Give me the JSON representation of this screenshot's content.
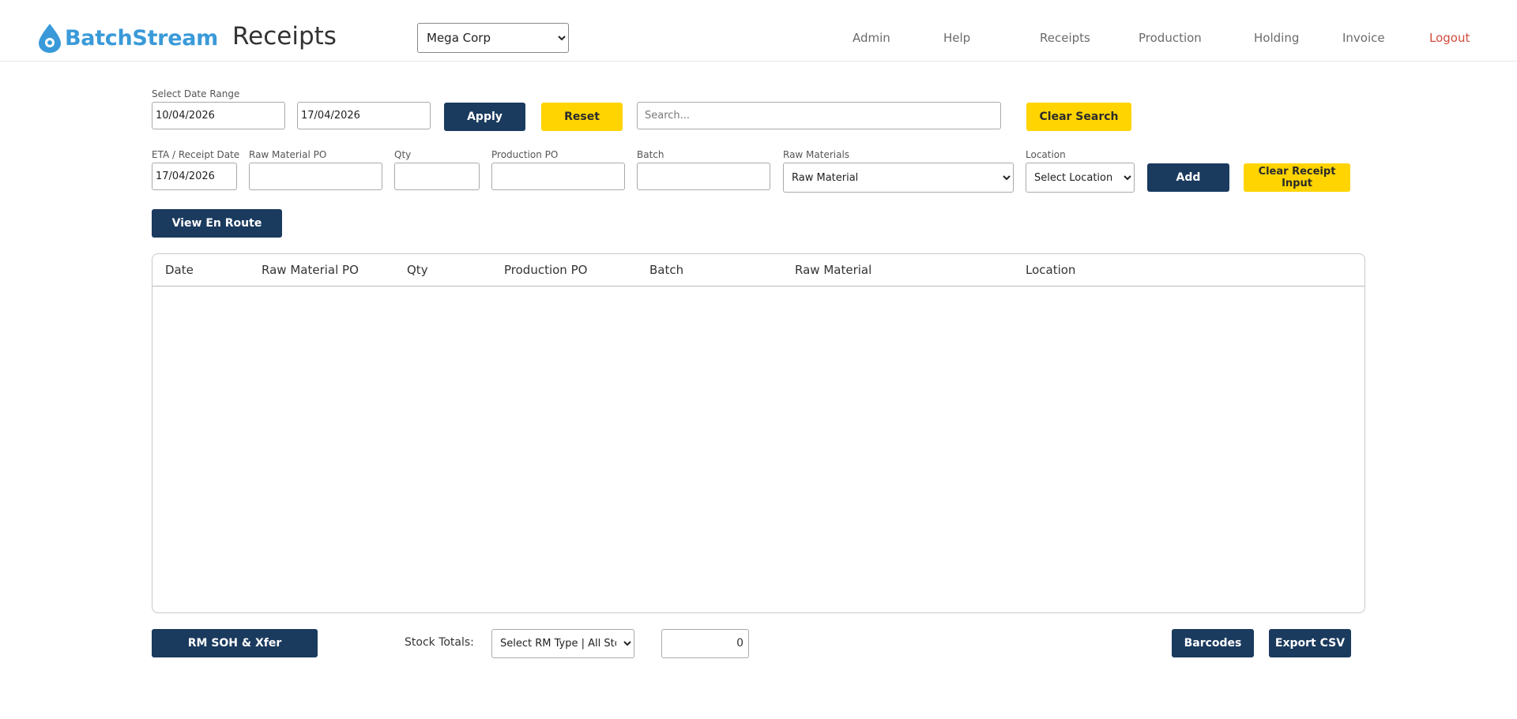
{
  "header": {
    "brand": "BatchStream",
    "page_title": "Receipts",
    "company": "Mega Corp",
    "nav": {
      "admin": "Admin",
      "help": "Help",
      "receipts": "Receipts",
      "production": "Production",
      "holding": "Holding",
      "invoice": "Invoice",
      "logout": "Logout"
    }
  },
  "filters": {
    "date_range_label": "Select Date Range",
    "date_from": "10/04/2026",
    "date_to": "17/04/2026",
    "apply_label": "Apply",
    "reset_label": "Reset",
    "search_placeholder": "Search...",
    "clear_search_label": "Clear Search"
  },
  "receipt_input": {
    "eta_label": "ETA / Receipt Date",
    "eta_value": "17/04/2026",
    "rm_po_label": "Raw Material PO",
    "qty_label": "Qty",
    "prod_po_label": "Production PO",
    "batch_label": "Batch",
    "raw_materials_label": "Raw Materials",
    "raw_material_selected": "Raw Material",
    "location_label": "Location",
    "location_selected": "Select Location",
    "add_label": "Add",
    "clear_input_label": "Clear Receipt Input"
  },
  "view_en_route_label": "View En Route",
  "table": {
    "columns": [
      "Date",
      "Raw Material PO",
      "Qty",
      "Production PO",
      "Batch",
      "Raw Material",
      "Location"
    ],
    "rows": []
  },
  "footer": {
    "rm_soh_label": "RM SOH & Xfer",
    "stock_totals_label": "Stock Totals:",
    "rm_type_selected": "Select RM Type | All Stock",
    "total_value": "0",
    "barcodes_label": "Barcodes",
    "export_label": "Export CSV"
  },
  "colors": {
    "navy": "#1a3a5e",
    "yellow": "#ffd400",
    "brand_blue": "#3a9ad9",
    "logout_red": "#d14b3c"
  }
}
